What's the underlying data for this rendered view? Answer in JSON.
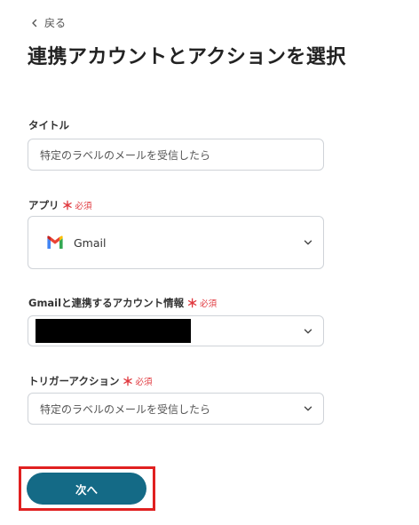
{
  "nav": {
    "back_label": "戻る"
  },
  "page_title": "連携アカウントとアクションを選択",
  "fields": {
    "title": {
      "label": "タイトル",
      "value": "特定のラベルのメールを受信したら"
    },
    "app": {
      "label": "アプリ",
      "required_star": "＊",
      "required_text": "必須",
      "value": "Gmail",
      "icon": "gmail-logo"
    },
    "account": {
      "label": "Gmailと連携するアカウント情報",
      "required_star": "＊",
      "required_text": "必須",
      "value_redacted": true
    },
    "trigger": {
      "label": "トリガーアクション",
      "required_star": "＊",
      "required_text": "必須",
      "value": "特定のラベルのメールを受信したら"
    }
  },
  "buttons": {
    "next_label": "次へ"
  },
  "colors": {
    "primary": "#146a86",
    "required": "#e0383e",
    "highlight": "#e02020"
  }
}
